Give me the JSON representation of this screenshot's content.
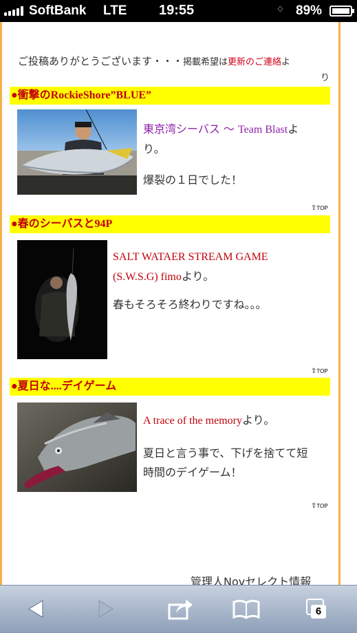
{
  "status": {
    "carrier": "SoftBank",
    "network": "LTE",
    "time": "19:55",
    "battery": "89%"
  },
  "intro": {
    "lead": "ご投稿ありがとうございます・・・",
    "small": "掲載希望は",
    "link": "更新のご連絡",
    "tail_a": "よ",
    "tail_b": "り"
  },
  "posts": [
    {
      "heading_dot": "●",
      "heading": "衝撃のRockieShore”BLUE”",
      "source_jp": "東京湾シーバス 〜 ",
      "source_en": "Team Blast",
      "source_suffix": "よ",
      "line2": "り。",
      "body": "爆裂の１日でした！",
      "top_label": "TOP"
    },
    {
      "heading_dot": "●",
      "heading": "春のシーバスと94P",
      "source_line1": "SALT WATAER STREAM GAME",
      "source_line2": "(S.W.S.G) fimo",
      "source_suffix": "より。",
      "body": "春もそろそろ終わりですね。。。",
      "top_label": "TOP"
    },
    {
      "heading_dot": "●",
      "heading": "夏日な....デイゲーム",
      "source": "A trace of the memory",
      "source_suffix": "より。",
      "body_line1": "夏日と言う事で、下げを捨てて短",
      "body_line2": "時間のデイゲーム！",
      "top_label": "TOP"
    }
  ],
  "footer": "管理人Novセレクト情報",
  "toolbar": {
    "tab_count": "6",
    "icons": [
      "back-icon",
      "forward-icon",
      "share-icon",
      "bookmarks-icon",
      "tabs-icon"
    ]
  }
}
